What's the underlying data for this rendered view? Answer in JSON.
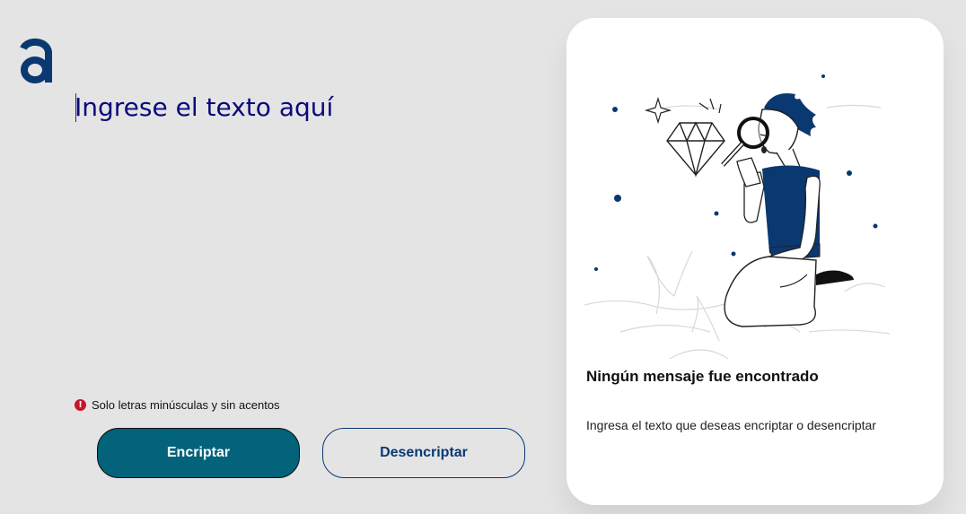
{
  "brand": {
    "logo_icon": "alura-a-logo-icon",
    "color": "#0a3871"
  },
  "input": {
    "placeholder": "Ingrese el texto aquí",
    "value": ""
  },
  "hint": {
    "icon": "exclamation-circle-icon",
    "text": "Solo letras minúsculas y sin acentos",
    "icon_color": "#c5162c"
  },
  "buttons": {
    "encrypt_label": "Encriptar",
    "decrypt_label": "Desencriptar",
    "encrypt_color": "#02637b"
  },
  "result_panel": {
    "illustration": "person-with-magnifying-glass-illustration",
    "title": "Ningún mensaje fue encontrado",
    "subtitle": "Ingresa el texto que deseas encriptar o desencriptar"
  }
}
